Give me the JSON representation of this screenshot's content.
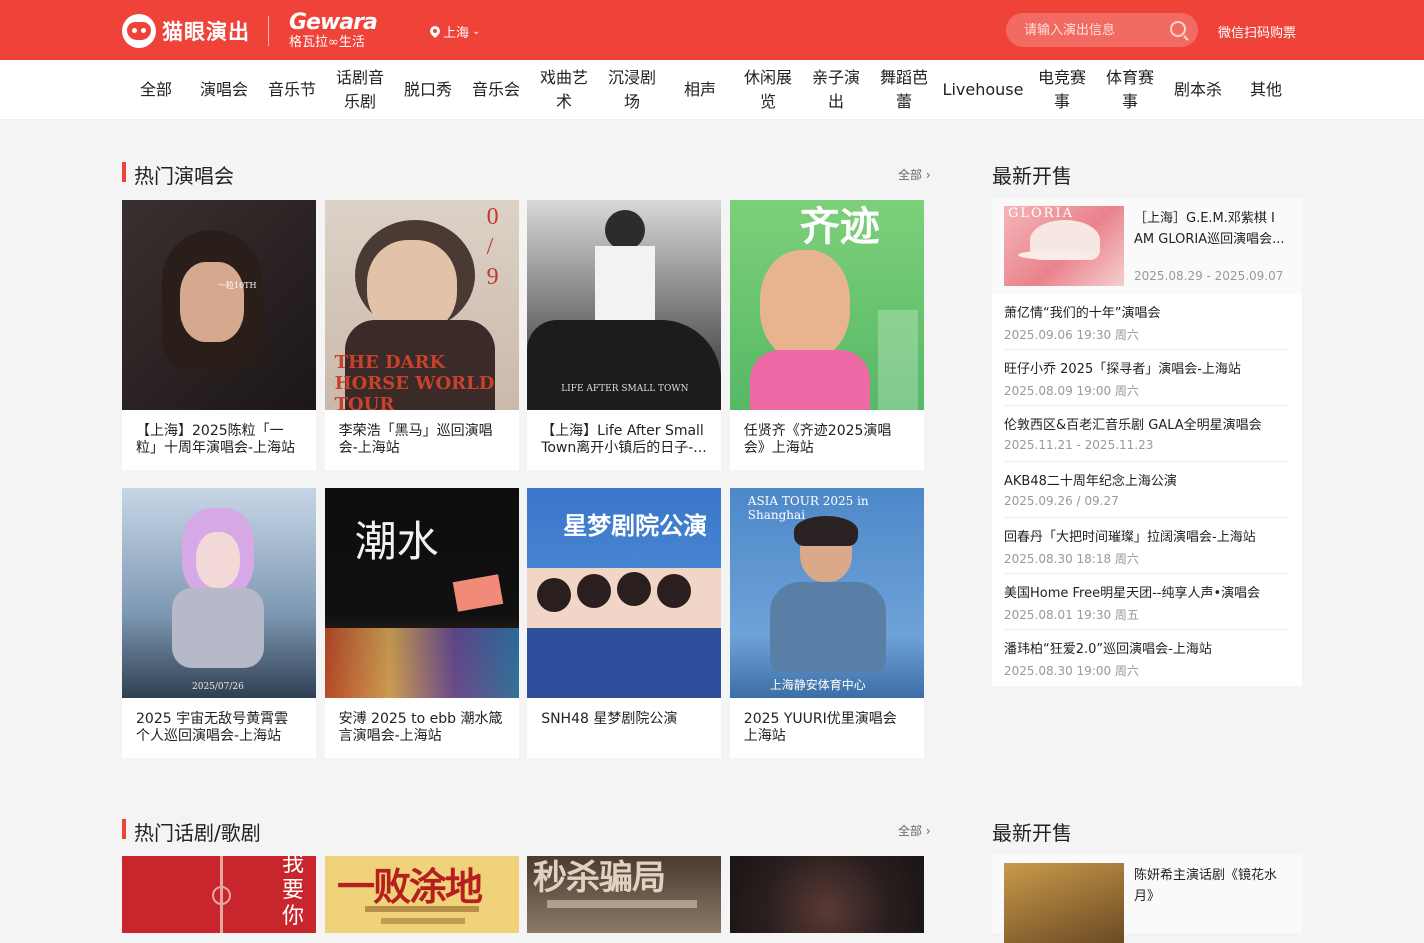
{
  "header": {
    "brand": "猫眼演出",
    "gewara_main": "Gewara",
    "gewara_sub": "格瓦拉∞生活",
    "city": "上海",
    "search_placeholder": "请输入演出信息",
    "wechat": "微信扫码购票"
  },
  "categories": [
    "全部",
    "演唱会",
    "音乐节",
    "话剧音乐剧",
    "脱口秀",
    "音乐会",
    "戏曲艺术",
    "沉浸剧场",
    "相声",
    "休闲展览",
    "亲子演出",
    "舞蹈芭蕾",
    "Livehouse",
    "电竞赛事",
    "体育赛事",
    "剧本杀",
    "其他"
  ],
  "concerts": {
    "title": "热门演唱会",
    "more": "全部",
    "items": [
      {
        "title": "【上海】2025陈粒「一粒」十周年演唱会-上海站",
        "poster_text": "一粒10TH"
      },
      {
        "title": "李荣浩「黑马」巡回演唱会-上海站",
        "poster_text": "THE DARK HORSE WORLD TOUR"
      },
      {
        "title": "【上海】Life After Small Town离开小镇后的日子-...",
        "poster_text": "LIFE AFTER SMALL TOWN"
      },
      {
        "title": "任贤齐《齐迹2025演唱会》上海站",
        "poster_text": "齐迹"
      },
      {
        "title": "2025 宇宙无敌号黄霄雲个人巡回演唱会-上海站",
        "poster_text": "2025/07/26"
      },
      {
        "title": "安溥 2025 to ebb 潮水箴言演唱会-上海站",
        "poster_text": "潮水"
      },
      {
        "title": "SNH48 星梦剧院公演",
        "poster_text": "星梦剧院公演"
      },
      {
        "title": "2025 YUURI优里演唱会上海站",
        "poster_text": "ASIA TOUR 2025 in Shanghai"
      }
    ]
  },
  "latest": {
    "title": "最新开售",
    "featured": {
      "title": "［上海］G.E.M.邓紫棋 I AM GLORIA巡回演唱会...",
      "date": "2025.08.29 - 2025.09.07"
    },
    "items": [
      {
        "title": "萧亿情“我们的十年”演唱会",
        "date": "2025.09.06 19:30 周六"
      },
      {
        "title": "旺仔小乔 2025「探寻者」演唱会-上海站",
        "date": "2025.08.09 19:00 周六"
      },
      {
        "title": "伦敦西区&百老汇音乐剧 GALA全明星演唱会",
        "date": "2025.11.21 - 2025.11.23"
      },
      {
        "title": "AKB48二十周年纪念上海公演",
        "date": "2025.09.26 / 09.27"
      },
      {
        "title": "回春丹「大把时间璀璨」拉阔演唱会-上海站",
        "date": "2025.08.30 18:18 周六"
      },
      {
        "title": "美国Home Free明星天团--纯享人声•演唱会",
        "date": "2025.08.01 19:30 周五"
      },
      {
        "title": "潘玮柏“狂爱2.0”巡回演唱会-上海站",
        "date": "2025.08.30 19:00 周六"
      }
    ]
  },
  "drama": {
    "title": "热门话剧/歌剧",
    "more": "全部",
    "poster_texts": [
      "我要你",
      "一败涂地",
      "秒杀骗局",
      ""
    ]
  },
  "latest2": {
    "title": "最新开售",
    "featured": {
      "title": "陈妍希主演话剧《镜花水月》"
    }
  }
}
